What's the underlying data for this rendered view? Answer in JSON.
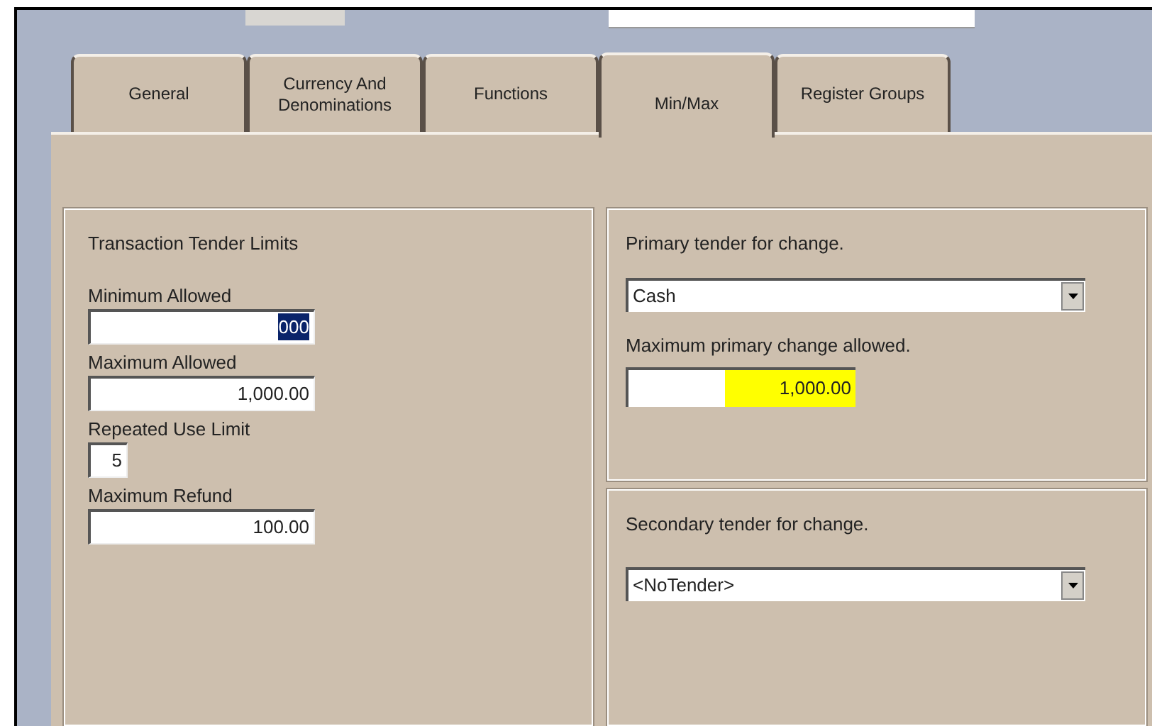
{
  "tabs": [
    {
      "label": "General",
      "selected": false
    },
    {
      "label": "Currency And\nDenominations",
      "selected": false
    },
    {
      "label": "Functions",
      "selected": false
    },
    {
      "label": "Min/Max",
      "selected": true
    },
    {
      "label": "Register Groups",
      "selected": false
    }
  ],
  "limits": {
    "title": "Transaction Tender Limits",
    "fields": [
      {
        "label": "Minimum Allowed",
        "value": "000",
        "kind": "wide",
        "text_selected": true
      },
      {
        "label": "Maximum Allowed",
        "value": "1,000.00",
        "kind": "wide",
        "text_selected": false
      },
      {
        "label": "Repeated Use Limit",
        "value": "5",
        "kind": "narrow",
        "text_selected": false
      },
      {
        "label": "Maximum Refund",
        "value": "100.00",
        "kind": "wide",
        "text_selected": false
      }
    ]
  },
  "primary": {
    "label": "Primary tender for change.",
    "value": "Cash",
    "max_label": "Maximum primary change allowed.",
    "max_value": "1,000.00",
    "max_highlighted": true
  },
  "secondary": {
    "label": "Secondary tender for change.",
    "value": "<NoTender>"
  }
}
